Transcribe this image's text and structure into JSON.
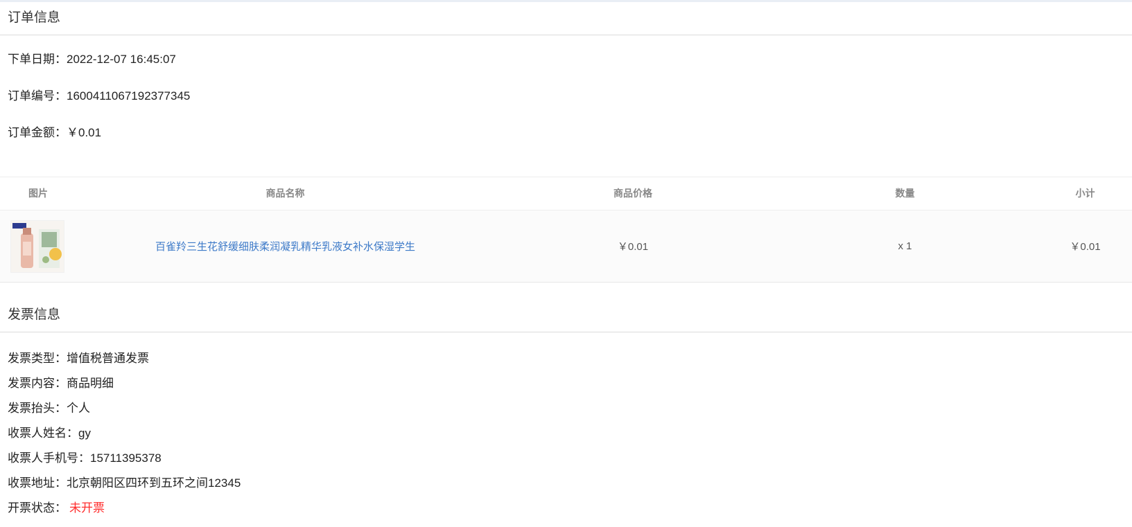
{
  "order_section": {
    "title": "订单信息",
    "date_label": "下单日期：",
    "date_value": "2022-12-07 16:45:07",
    "number_label": "订单编号：",
    "number_value": "1600411067192377345",
    "amount_label": "订单金额：",
    "amount_value": "￥0.01"
  },
  "goods_table": {
    "headers": {
      "image": "图片",
      "name": "商品名称",
      "price": "商品价格",
      "quantity": "数量",
      "subtotal": "小计"
    },
    "rows": [
      {
        "name": "百雀羚三生花舒缓细肤柔润凝乳精华乳液女补水保湿学生",
        "price": "￥0.01",
        "quantity": "x 1",
        "subtotal": "￥0.01"
      }
    ]
  },
  "invoice_section": {
    "title": "发票信息",
    "type_label": "发票类型：",
    "type_value": "增值税普通发票",
    "content_label": "发票内容：",
    "content_value": "商品明细",
    "header_label": "发票抬头：",
    "header_value": "个人",
    "receiver_name_label": "收票人姓名：",
    "receiver_name_value": "gy",
    "receiver_phone_label": "收票人手机号：",
    "receiver_phone_value": "15711395378",
    "receiver_address_label": "收票地址：",
    "receiver_address_value": "北京朝阳区四环到五环之间12345",
    "status_label": "开票状态：",
    "status_value": "未开票"
  },
  "colors": {
    "link": "#3d7ac8",
    "status_pending": "#ff2d2d",
    "divider": "#dcdcdc"
  },
  "icons": {
    "product_thumbnail": "product-image"
  }
}
